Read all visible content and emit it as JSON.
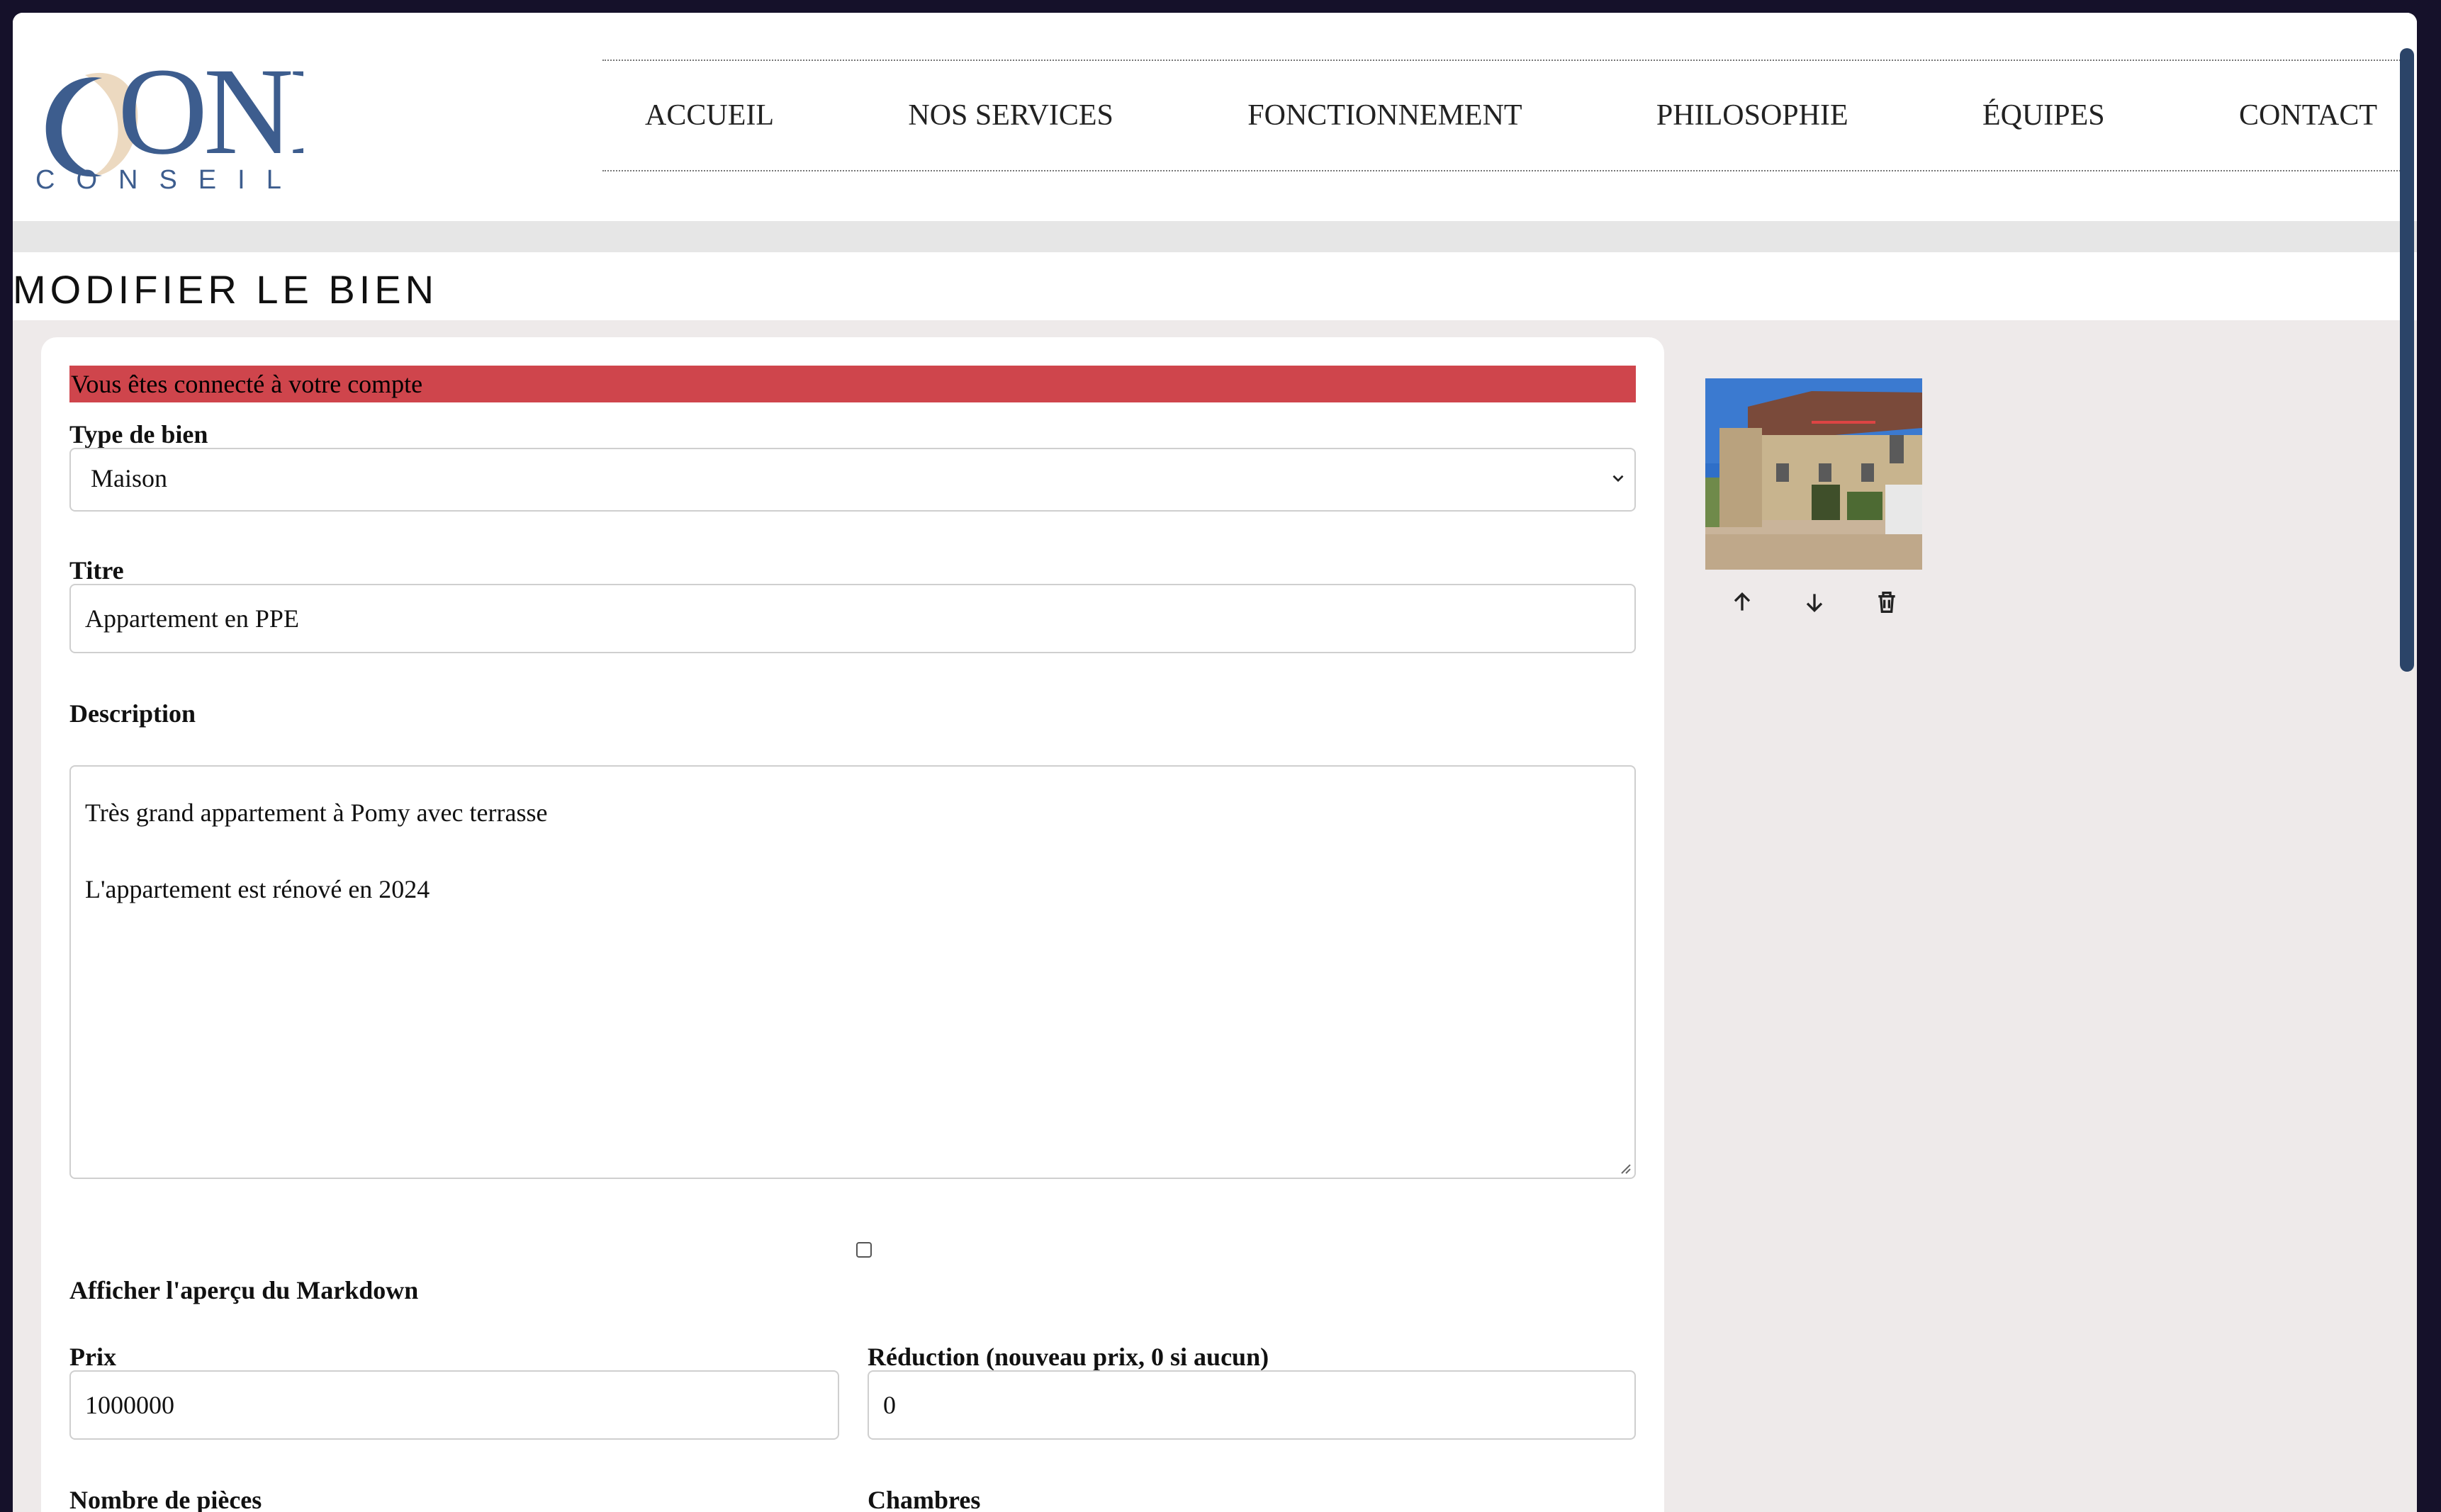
{
  "brand": {
    "logo_text": "ONE",
    "logo_subtext": "CONSEILS",
    "primary": "#3d5d8e",
    "accent": "#ecd9c0"
  },
  "nav": {
    "items": [
      {
        "label": "ACCUEIL"
      },
      {
        "label": "NOS SERVICES"
      },
      {
        "label": "FONCTIONNEMENT"
      },
      {
        "label": "PHILOSOPHIE"
      },
      {
        "label": "ÉQUIPES"
      },
      {
        "label": "CONTACT"
      }
    ]
  },
  "page": {
    "title": "MODIFIER LE BIEN"
  },
  "alert": {
    "text": "Vous êtes connecté à votre compte",
    "color": "#cf454c"
  },
  "form": {
    "type": {
      "label": "Type de bien",
      "value": "Maison"
    },
    "titre": {
      "label": "Titre",
      "value": "Appartement en PPE"
    },
    "description": {
      "label": "Description",
      "line1": "Très grand appartement à Pomy avec terrasse",
      "line2": "L'appartement est rénové en 2024"
    },
    "markdown_preview": {
      "label": "Afficher l'aperçu du Markdown",
      "checked": false
    },
    "prix": {
      "label": "Prix",
      "value": "1000000"
    },
    "reduction": {
      "label": "Réduction (nouveau prix, 0 si aucun)",
      "value": "0"
    },
    "pieces": {
      "label": "Nombre de pièces"
    },
    "chambres": {
      "label": "Chambres"
    }
  },
  "images": {
    "controls": [
      {
        "icon": "arrow-up-icon"
      },
      {
        "icon": "arrow-down-icon"
      },
      {
        "icon": "trash-icon"
      }
    ]
  }
}
